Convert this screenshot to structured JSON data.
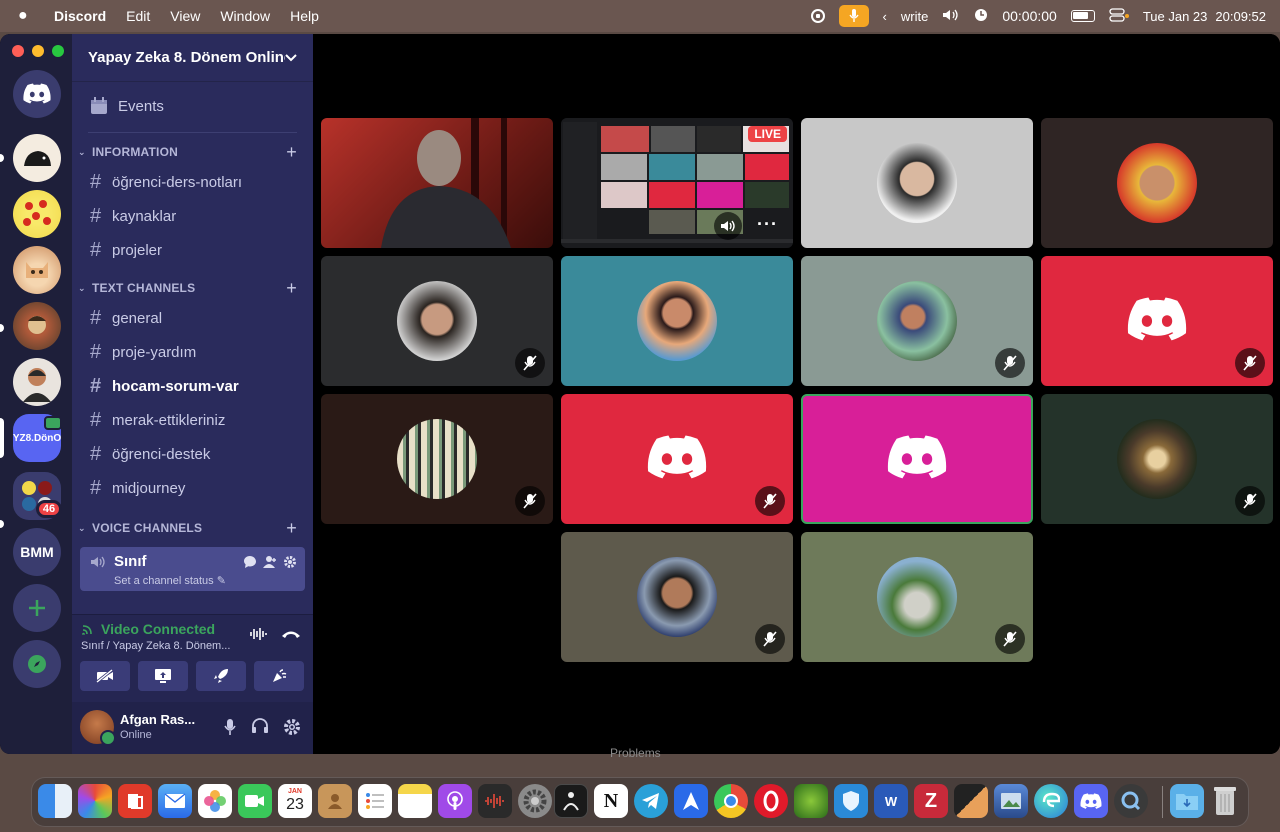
{
  "menubar": {
    "app_name": "Discord",
    "items": [
      "Edit",
      "View",
      "Window",
      "Help"
    ],
    "write_label": "write",
    "timer": "00:00:00",
    "date": "Tue Jan 23",
    "time": "20:09:52"
  },
  "server": {
    "name": "Yapay Zeka 8. Dönem Online"
  },
  "events_label": "Events",
  "categories": {
    "information": "INFORMATION",
    "text": "TEXT CHANNELS",
    "voice": "VOICE CHANNELS"
  },
  "info_channels": [
    "öğrenci-ders-notları",
    "kaynaklar",
    "projeler"
  ],
  "text_channels": [
    "general",
    "proje-yardım",
    "hocam-sorum-var",
    "merak-ettikleriniz",
    "öğrenci-destek",
    "midjourney"
  ],
  "voice_channel": {
    "name": "Sınıf",
    "status_placeholder": "Set a channel status"
  },
  "rtc": {
    "status": "Video Connected",
    "location": "Sınıf / Yapay Zeka 8. Dönem..."
  },
  "user": {
    "name": "Afgan Ras...",
    "status": "Online"
  },
  "guilds": {
    "yz_label": "YZ8.DönO",
    "badge_count": "46",
    "bmm_label": "BMM"
  },
  "stream": {
    "live_label": "LIVE"
  },
  "dock": {
    "calendar_month": "JAN",
    "calendar_day": "23"
  },
  "background_text": "Problems",
  "colors": {
    "discord_blurple": "#5865f2",
    "connected_green": "#3ba55d",
    "live_red": "#ed4245",
    "tile_red": "#e0283f",
    "tile_pink": "#d81f98",
    "tile_teal": "#3a8a9a"
  }
}
